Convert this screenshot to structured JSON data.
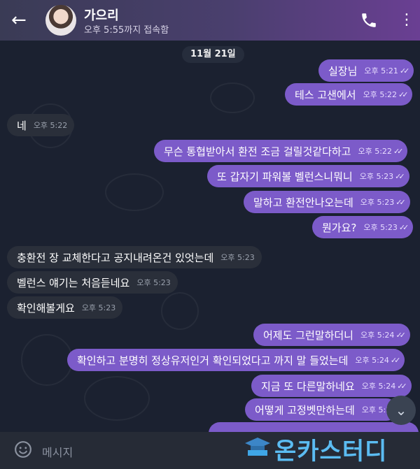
{
  "header": {
    "contact_name": "가으리",
    "status": "오후 5:55까지 접속함",
    "back_icon": "back-arrow-icon",
    "call_icon": "phone-icon",
    "menu_icon": "more-vertical-icon"
  },
  "chat": {
    "date_label": "11월 21일",
    "messages": [
      {
        "dir": "out",
        "text": "실장님",
        "time": "오후 5:21"
      },
      {
        "dir": "out",
        "text": "테스 고샌에서",
        "time": "오후 5:22"
      },
      {
        "dir": "in",
        "text": "네",
        "time": "오후 5:22"
      },
      {
        "dir": "out",
        "text": "무슨 통협받아서 환전 조금 걸릴것같다하고",
        "time": "오후 5:22"
      },
      {
        "dir": "out",
        "text": "또 갑자기 파워볼 벨런스니뭐니",
        "time": "오후 5:23"
      },
      {
        "dir": "out",
        "text": "말하고 환전안나오는데",
        "time": "오후 5:23"
      },
      {
        "dir": "out",
        "text": "뭔가요?",
        "time": "오후 5:23"
      },
      {
        "dir": "in",
        "text": "충환전 장 교체한다고 공지내려온건 있엇는데",
        "time": "오후 5:23"
      },
      {
        "dir": "in",
        "text": "벨런스 얘기는 처음듣네요",
        "time": "오후 5:23"
      },
      {
        "dir": "in",
        "text": "확인해볼게요",
        "time": "오후 5:23"
      },
      {
        "dir": "out",
        "text": "어제도 그런말하더니",
        "time": "오후 5:24"
      },
      {
        "dir": "out",
        "text": "확인하고 분명히 정상유저인거 확인되었다고 까지 말 들었는데",
        "time": "오후 5:24"
      },
      {
        "dir": "out",
        "text": "지금 또 다른말하네요",
        "time": "오후 5:24"
      },
      {
        "dir": "out",
        "text": "어떻게 고정벳만하는데",
        "time": "오후 5:2"
      }
    ],
    "read_ticks": "✓✓"
  },
  "composer": {
    "placeholder": "메시지",
    "emoji_icon": "emoji-icon"
  },
  "watermark": {
    "text": "온카스터디"
  },
  "colors": {
    "outgoing_bubble": "#7c5bc9",
    "incoming_bubble": "#2a2f3a",
    "background": "#1b2130"
  }
}
